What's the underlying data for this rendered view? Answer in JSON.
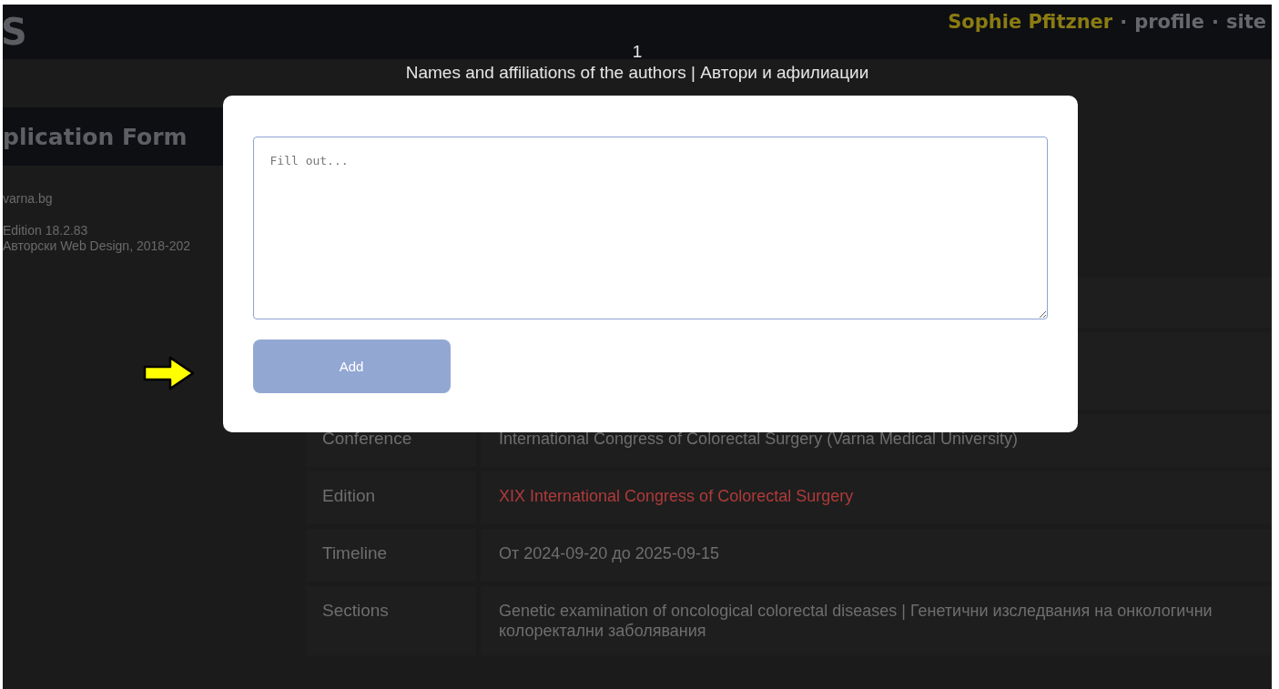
{
  "header": {
    "logo": "S",
    "nav": [
      {
        "text": "Sophie Pfitzner",
        "kind": "user"
      },
      {
        "text": "·",
        "kind": "separator"
      },
      {
        "text": "profile",
        "kind": "link"
      },
      {
        "text": "·",
        "kind": "separator"
      },
      {
        "text": "site",
        "kind": "link"
      }
    ]
  },
  "sidebar": {
    "title": "plication Form",
    "lines": [
      "varna.bg",
      "Edition 18.2.83",
      "Авторски Web Design, 2018-202"
    ]
  },
  "table": {
    "rows": [
      {
        "label": "Conference",
        "value": "International Congress of Colorectal Surgery (Varna Medical University)",
        "kind": "text"
      },
      {
        "label": "Edition",
        "value": "XIX International Congress of Colorectal Surgery",
        "kind": "link"
      },
      {
        "label": "Timeline",
        "value": "От 2024-09-20 до 2025-09-15",
        "kind": "text"
      },
      {
        "label": "Sections",
        "value": "Genetic examination of oncological colorectal diseases | Генетични изследвания на онкологични колоректални заболявания",
        "kind": "text"
      }
    ]
  },
  "modal": {
    "step": "1",
    "title": "Names and affiliations of the authors | Автори и афилиации",
    "textarea": {
      "placeholder": "Fill out..."
    },
    "button": {
      "label": "Add",
      "disabled": true
    }
  }
}
